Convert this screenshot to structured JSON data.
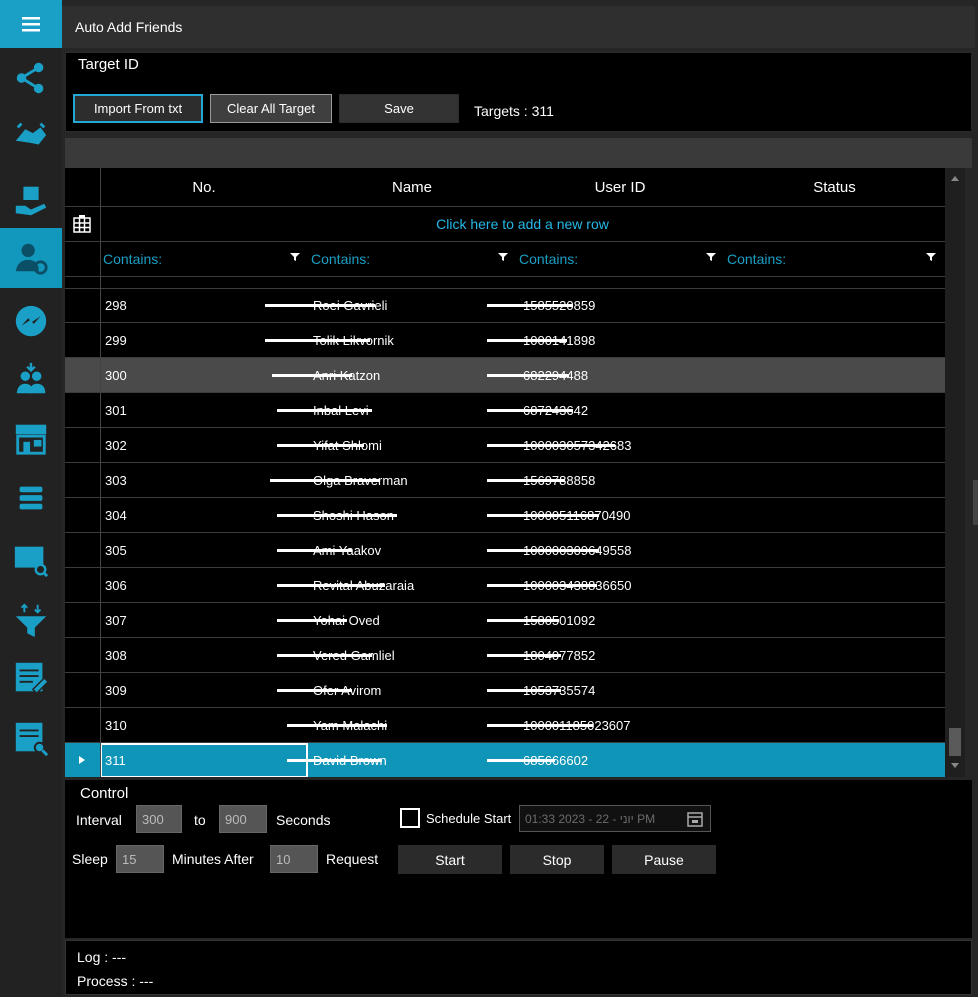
{
  "app": {
    "title": "Auto Add Friends"
  },
  "sidebar": {
    "menu_icon": "hamburger-icon",
    "items": [
      {
        "icon": "share-icon"
      },
      {
        "icon": "handshake-icon"
      },
      {
        "icon": "hand-box-icon"
      },
      {
        "icon": "add-friend-icon",
        "active": true
      },
      {
        "icon": "messenger-icon"
      },
      {
        "icon": "group-users-icon"
      },
      {
        "icon": "store-icon"
      },
      {
        "icon": "server-list-icon"
      },
      {
        "icon": "chat-search-icon"
      },
      {
        "icon": "funnel-icon"
      },
      {
        "icon": "list-edit-icon"
      },
      {
        "icon": "list-search-icon"
      }
    ]
  },
  "target": {
    "section_label": "Target ID",
    "import_label": "Import From txt",
    "clear_label": "Clear All Target",
    "save_label": "Save",
    "targets_text": "Targets :  311"
  },
  "grid": {
    "columns": [
      "No.",
      "Name",
      "User ID",
      "Status"
    ],
    "add_row_text": "Click here to add a new row",
    "filter_text": "Contains:",
    "rows": [
      {
        "no": "298",
        "name": "Roei Gavrieli",
        "uid": "1585520859"
      },
      {
        "no": "299",
        "name": "Tolik Likvornik",
        "uid": "1000141898"
      },
      {
        "no": "300",
        "name": "Anri Katzon",
        "uid": "682294488"
      },
      {
        "no": "301",
        "name": "Inbal Levi",
        "uid": "687243642"
      },
      {
        "no": "302",
        "name": "Yifat Shlomi",
        "uid": "100003057342683"
      },
      {
        "no": "303",
        "name": "Olga Braverman",
        "uid": "1569788858"
      },
      {
        "no": "304",
        "name": "Shoshi Hason",
        "uid": "100005116870490"
      },
      {
        "no": "305",
        "name": "Ami Yaakov",
        "uid": "100000309649558"
      },
      {
        "no": "306",
        "name": "Revital Abuzaraia",
        "uid": "100003438836650"
      },
      {
        "no": "307",
        "name": "Yohai Oved",
        "uid": "1580501092"
      },
      {
        "no": "308",
        "name": "Vered Gamliel",
        "uid": "1804077852"
      },
      {
        "no": "309",
        "name": "Ofer Avirom",
        "uid": "1053735574"
      },
      {
        "no": "310",
        "name": "Yam Malachi",
        "uid": "100001185023607"
      },
      {
        "no": "311",
        "name": "David Brown",
        "uid": "685666602"
      }
    ]
  },
  "control": {
    "section_label": "Control",
    "interval_label": "Interval",
    "interval_from": "300",
    "to_label": "to",
    "interval_to": "900",
    "seconds_label": "Seconds",
    "schedule_label": "Schedule Start",
    "schedule_value": "01:33 2023 - 22 - יוני PM",
    "sleep_label": "Sleep",
    "sleep_value": "15",
    "minutes_after_label": "Minutes After",
    "request_value": "10",
    "request_label": "Request",
    "start_label": "Start",
    "stop_label": "Stop",
    "pause_label": "Pause"
  },
  "log": {
    "log_text": "Log :   ---",
    "process_text": "Process :   ---"
  }
}
